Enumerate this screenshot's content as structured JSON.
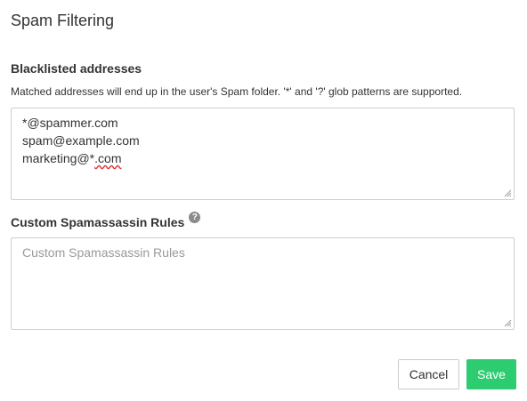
{
  "dialog": {
    "title": "Spam Filtering"
  },
  "blacklist": {
    "label": "Blacklisted addresses",
    "help": "Matched addresses will end up in the user's Spam folder. '*' and '?' glob patterns are supported.",
    "lines": [
      "*@spammer.com",
      "spam@example.com",
      "marketing@*.com"
    ]
  },
  "rules": {
    "label": "Custom Spamassassin Rules",
    "placeholder": "Custom Spamassassin Rules",
    "help_icon": "question-circle-icon"
  },
  "buttons": {
    "cancel": "Cancel",
    "save": "Save"
  },
  "colors": {
    "save_button": "#2ecc71",
    "spellcheck_underline": "#dd3333"
  }
}
